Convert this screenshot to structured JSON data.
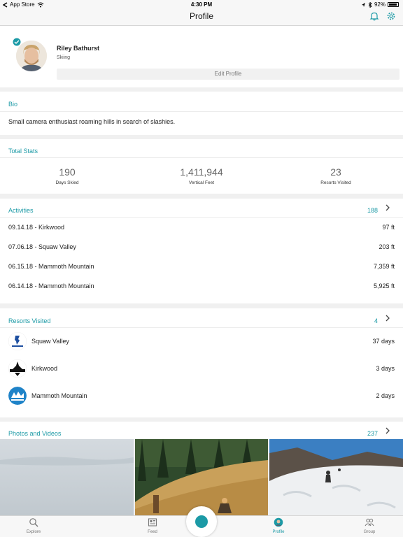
{
  "status_bar": {
    "carrier": "App Store",
    "time": "4:30 PM",
    "battery": "92%"
  },
  "nav": {
    "title": "Profile"
  },
  "profile": {
    "name": "Riley Bathurst",
    "sport": "Skiing",
    "edit_label": "Edit Profile"
  },
  "bio": {
    "title": "Bio",
    "text": "Small camera enthusiast roaming hills in search of slashies."
  },
  "stats": {
    "title": "Total Stats",
    "items": [
      {
        "value": "190",
        "label": "Days Skied"
      },
      {
        "value": "1,411,944",
        "label": "Vertical Feet"
      },
      {
        "value": "23",
        "label": "Resorts Visited"
      }
    ]
  },
  "activities": {
    "title": "Activities",
    "count": "188",
    "items": [
      {
        "name": "09.14.18 - Kirkwood",
        "value": "97 ft"
      },
      {
        "name": "07.06.18 - Squaw Valley",
        "value": "203 ft"
      },
      {
        "name": "06.15.18 - Mammoth Mountain",
        "value": "7,359 ft"
      },
      {
        "name": "06.14.18 - Mammoth Mountain",
        "value": "5,925 ft"
      }
    ]
  },
  "resorts": {
    "title": "Resorts Visited",
    "count": "4",
    "items": [
      {
        "name": "Squaw Valley",
        "value": "37 days"
      },
      {
        "name": "Kirkwood",
        "value": "3 days"
      },
      {
        "name": "Mammoth Mountain",
        "value": "2 days"
      }
    ]
  },
  "photos": {
    "title": "Photos and Videos",
    "count": "237"
  },
  "tabs": [
    {
      "label": "Explore",
      "icon": "search-icon",
      "active": false
    },
    {
      "label": "Feed",
      "icon": "feed-icon",
      "active": false
    },
    {
      "label": "Profile",
      "icon": "profile-avatar-icon",
      "active": true
    },
    {
      "label": "Group",
      "icon": "group-icon",
      "active": false
    }
  ],
  "colors": {
    "accent": "#1c9aa6",
    "background": "#f0f0f0"
  }
}
